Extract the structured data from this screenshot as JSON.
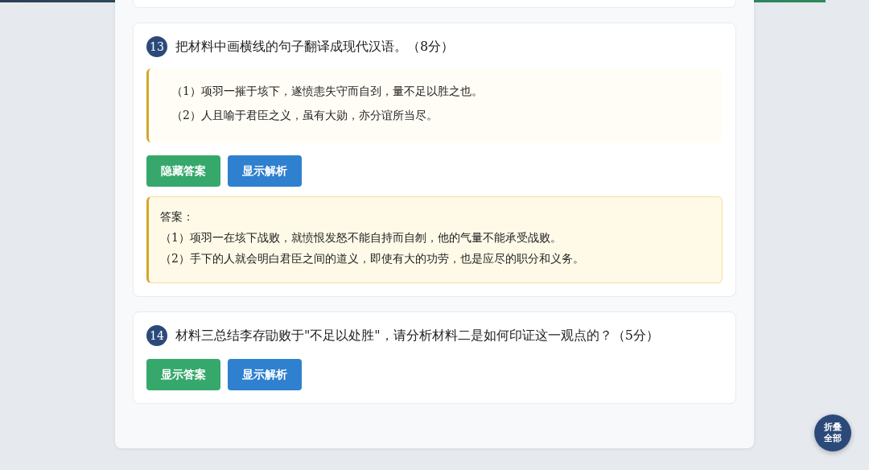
{
  "reading_progress": {
    "level": 0.95
  },
  "questions": [
    {
      "number": "13",
      "text": "把材料中画横线的句子翻译成现代汉语。（8分）",
      "materials": [
        "（1）项羽一摧于垓下，遂愤恚失守而自刭，量不足以胜之也。",
        "（2）人且喻于君臣之义，虽有大勋，亦分谊所当尽。"
      ],
      "buttons": [
        {
          "kind": "answer",
          "label": "隐藏答案"
        },
        {
          "kind": "analysis",
          "label": "显示解析"
        }
      ],
      "answer": {
        "title": "答案：",
        "lines": [
          "（1）项羽一在垓下战败，就愤恨发怒不能自持而自刎，他的气量不能承受战败。",
          "（2）手下的人就会明白君臣之间的道义，即使有大的功劳，也是应尽的职分和义务。"
        ]
      }
    },
    {
      "number": "14",
      "text": "材料三总结李存勖败于\"不足以处胜\"，请分析材料二是如何印证这一观点的？（5分）",
      "buttons": [
        {
          "kind": "answer",
          "label": "显示答案"
        },
        {
          "kind": "analysis",
          "label": "显示解析"
        }
      ]
    }
  ],
  "fold_button": {
    "label": "折叠全部"
  }
}
